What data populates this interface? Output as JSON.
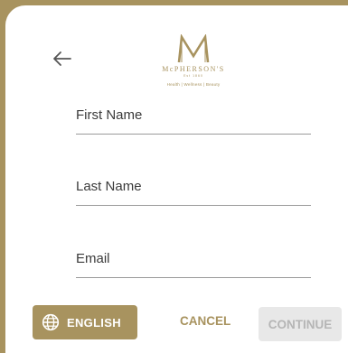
{
  "brand": {
    "letter": "M",
    "name": "McPHERSON'S",
    "est": "Est 1860",
    "tagline": "Health | Wellness | Beauty",
    "color": "#a8935f"
  },
  "form": {
    "fields": [
      {
        "label": "First Name"
      },
      {
        "label": "Last Name"
      },
      {
        "label": "Email"
      }
    ]
  },
  "footer": {
    "language_label": "ENGLISH",
    "cancel_label": "CANCEL",
    "continue_label": "CONTINUE"
  },
  "icons": {
    "back": "arrow-left-icon",
    "language": "globe-icon"
  }
}
